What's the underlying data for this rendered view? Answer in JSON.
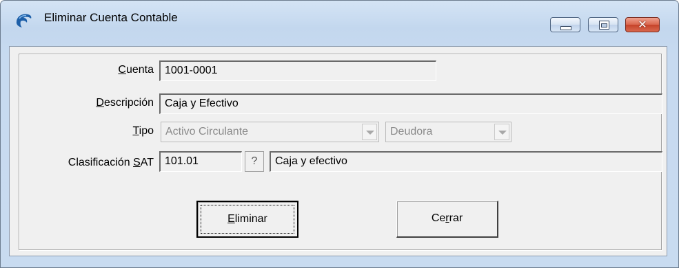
{
  "window": {
    "title": "Eliminar Cuenta Contable",
    "close_glyph": "✕",
    "icons": {
      "app": "dolphin-app-icon",
      "minimize": "minimize-icon",
      "maximize": "maximize-icon",
      "close": "close-icon"
    }
  },
  "form": {
    "cuenta": {
      "label_u": "C",
      "label_rest": "uenta",
      "value": "1001-0001"
    },
    "descripcion": {
      "label_u": "D",
      "label_rest": "escripción",
      "value": "Caja y Efectivo"
    },
    "tipo": {
      "label_u": "T",
      "label_rest": "ipo",
      "value": "Activo Circulante",
      "naturaleza": "Deudora"
    },
    "clasificacion": {
      "label_pre": "Clasificación ",
      "label_u": "S",
      "label_rest": "AT",
      "code": "101.01",
      "help_label": "?",
      "description": "Caja y efectivo"
    }
  },
  "buttons": {
    "eliminar": {
      "u": "E",
      "rest": "liminar"
    },
    "cerrar": {
      "pre": "Ce",
      "u": "r",
      "rest": "rar"
    }
  },
  "colors": {
    "titlebar": "#c3d7ee",
    "client": "#f0f0f0",
    "close_button": "#c6432a"
  }
}
